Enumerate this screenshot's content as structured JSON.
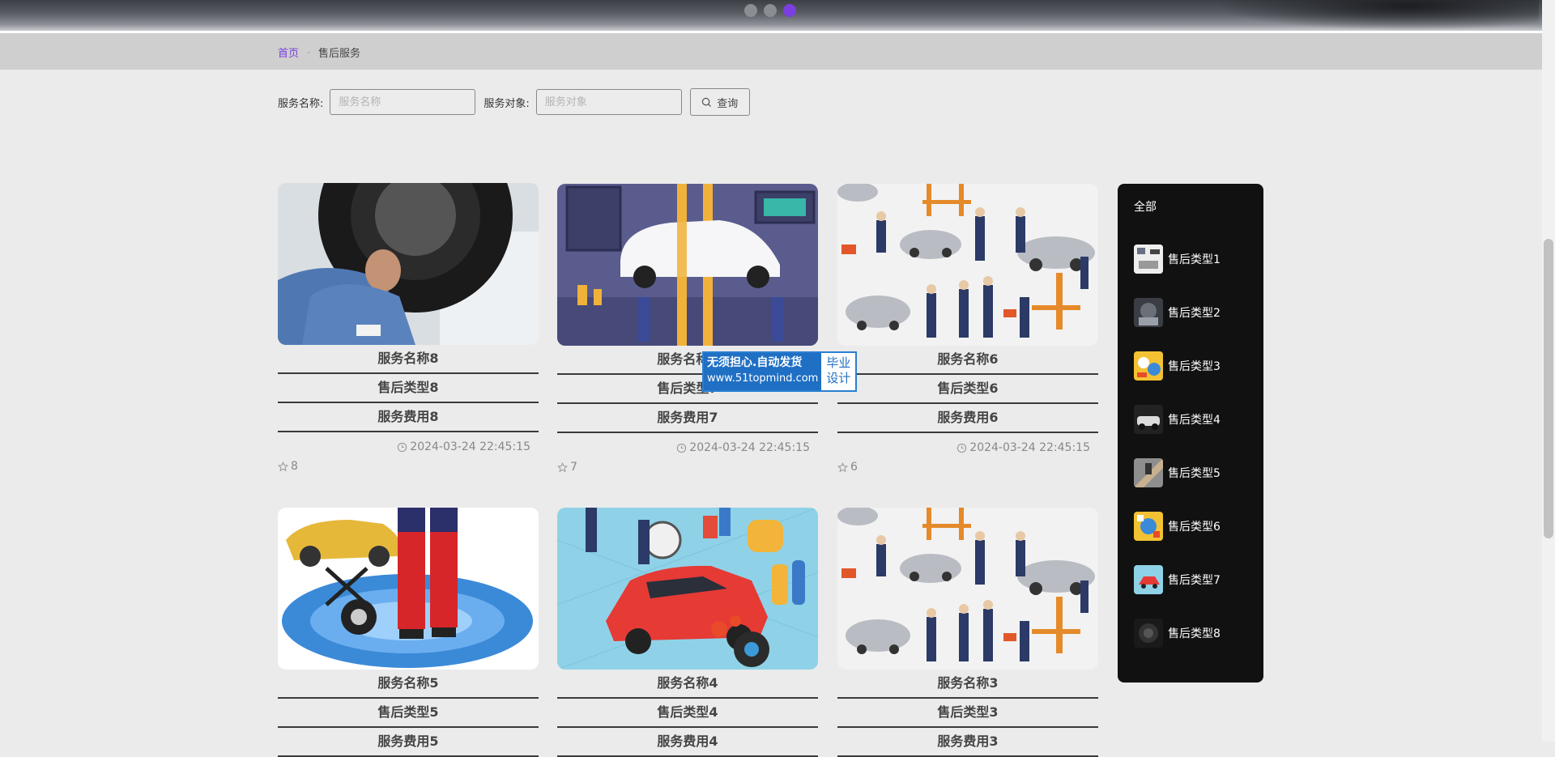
{
  "carousel": {
    "dot_count": 3,
    "active_index": 2,
    "accent": "#7b3fe0"
  },
  "breadcrumb": {
    "home": "首页",
    "separator": "-",
    "current": "售后服务"
  },
  "search": {
    "name_label": "服务名称:",
    "name_placeholder": "服务名称",
    "target_label": "服务对象:",
    "target_placeholder": "服务对象",
    "query_button": "查询"
  },
  "cards": [
    {
      "title": "服务名称8",
      "type": "售后类型8",
      "fee": "服务费用8",
      "date": "2024-03-24 22:45:15",
      "likes": "8",
      "image": "mechanic-under-car"
    },
    {
      "title": "服务名称7",
      "type": "售后类型7",
      "fee": "服务费用7",
      "date": "2024-03-24 22:45:15",
      "likes": "7",
      "image": "car-on-lift-illustration"
    },
    {
      "title": "服务名称6",
      "type": "售后类型6",
      "fee": "服务费用6",
      "date": "2024-03-24 22:45:15",
      "likes": "6",
      "image": "car-wash-pattern"
    },
    {
      "title": "服务名称5",
      "type": "售后类型5",
      "fee": "服务费用5",
      "image": "mechanics-with-yellow-car"
    },
    {
      "title": "服务名称4",
      "type": "售后类型4",
      "fee": "服务费用4",
      "image": "red-car-service-isometric"
    },
    {
      "title": "服务名称3",
      "type": "售后类型3",
      "fee": "服务费用3",
      "image": "car-wash-pattern"
    }
  ],
  "sidebar": {
    "all": "全部",
    "items": [
      {
        "label": "售后类型1"
      },
      {
        "label": "售后类型2"
      },
      {
        "label": "售后类型3"
      },
      {
        "label": "售后类型4"
      },
      {
        "label": "售后类型5"
      },
      {
        "label": "售后类型6"
      },
      {
        "label": "售后类型7"
      },
      {
        "label": "售后类型8"
      }
    ]
  },
  "watermark": {
    "line1": "无须担心.自动发货",
    "line2": "www.51topmind.com",
    "side1": "毕业",
    "side2": "设计"
  }
}
